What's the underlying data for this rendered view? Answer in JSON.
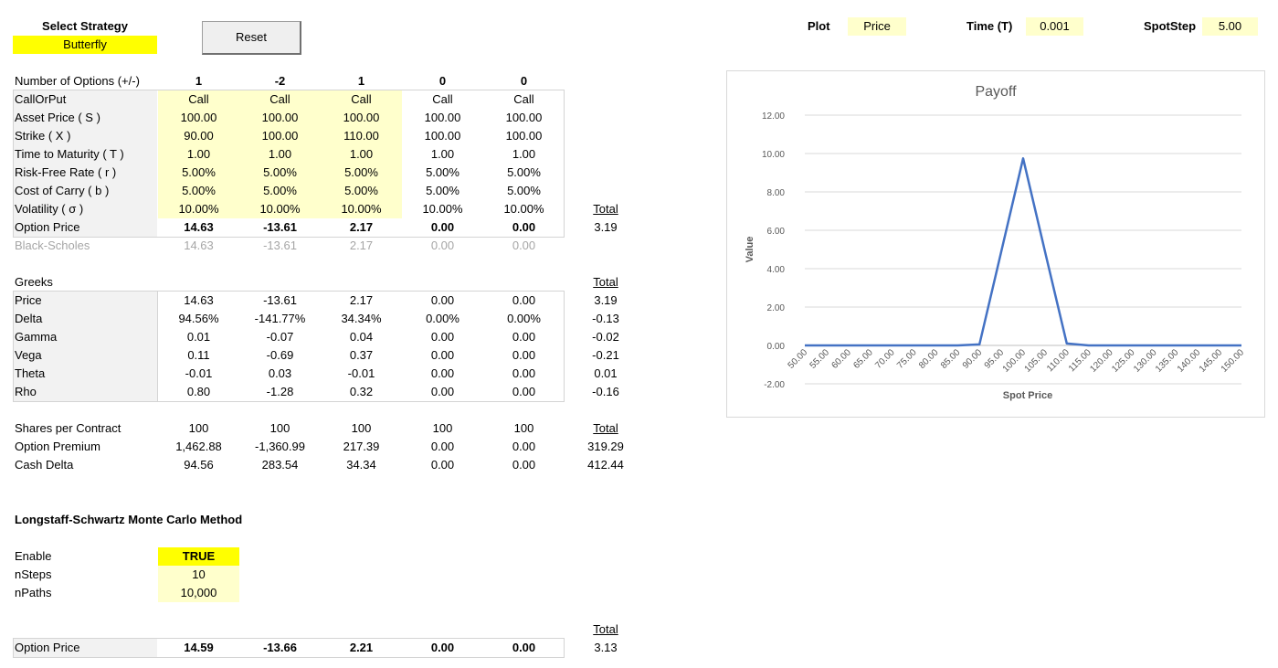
{
  "strategy": {
    "label": "Select Strategy",
    "value": "Butterfly"
  },
  "reset_label": "Reset",
  "controls": {
    "plot": {
      "label": "Plot",
      "value": "Price"
    },
    "time": {
      "label": "Time (T)",
      "value": "0.001"
    },
    "spotstep": {
      "label": "SpotStep",
      "value": "5.00"
    }
  },
  "num_options": {
    "label": "Number of Options (+/-)",
    "values": [
      "1",
      "-2",
      "1",
      "0",
      "0"
    ]
  },
  "inputs": [
    {
      "label": "CallOrPut",
      "values": [
        "Call",
        "Call",
        "Call",
        "Call",
        "Call"
      ]
    },
    {
      "label": "Asset Price ( S )",
      "values": [
        "100.00",
        "100.00",
        "100.00",
        "100.00",
        "100.00"
      ]
    },
    {
      "label": "Strike ( X )",
      "values": [
        "90.00",
        "100.00",
        "110.00",
        "100.00",
        "100.00"
      ]
    },
    {
      "label": "Time to Maturity ( T )",
      "values": [
        "1.00",
        "1.00",
        "1.00",
        "1.00",
        "1.00"
      ]
    },
    {
      "label": "Risk-Free Rate ( r )",
      "values": [
        "5.00%",
        "5.00%",
        "5.00%",
        "5.00%",
        "5.00%"
      ]
    },
    {
      "label": "Cost of Carry ( b )",
      "values": [
        "5.00%",
        "5.00%",
        "5.00%",
        "5.00%",
        "5.00%"
      ]
    },
    {
      "label": "Volatility ( σ )",
      "values": [
        "10.00%",
        "10.00%",
        "10.00%",
        "10.00%",
        "10.00%"
      ]
    }
  ],
  "option_price": {
    "label": "Option Price",
    "values": [
      "14.63",
      "-13.61",
      "2.17",
      "0.00",
      "0.00"
    ],
    "total": "3.19"
  },
  "black_scholes": {
    "label": "Black-Scholes",
    "values": [
      "14.63",
      "-13.61",
      "2.17",
      "0.00",
      "0.00"
    ]
  },
  "total_label": "Total",
  "greeks": {
    "title": "Greeks",
    "rows": [
      {
        "label": "Price",
        "values": [
          "14.63",
          "-13.61",
          "2.17",
          "0.00",
          "0.00"
        ],
        "total": "3.19"
      },
      {
        "label": "Delta",
        "values": [
          "94.56%",
          "-141.77%",
          "34.34%",
          "0.00%",
          "0.00%"
        ],
        "total": "-0.13"
      },
      {
        "label": "Gamma",
        "values": [
          "0.01",
          "-0.07",
          "0.04",
          "0.00",
          "0.00"
        ],
        "total": "-0.02"
      },
      {
        "label": "Vega",
        "values": [
          "0.11",
          "-0.69",
          "0.37",
          "0.00",
          "0.00"
        ],
        "total": "-0.21"
      },
      {
        "label": "Theta",
        "values": [
          "-0.01",
          "0.03",
          "-0.01",
          "0.00",
          "0.00"
        ],
        "total": "0.01"
      },
      {
        "label": "Rho",
        "values": [
          "0.80",
          "-1.28",
          "0.32",
          "0.00",
          "0.00"
        ],
        "total": "-0.16"
      }
    ]
  },
  "contracts": [
    {
      "label": "Shares per Contract",
      "values": [
        "100",
        "100",
        "100",
        "100",
        "100"
      ],
      "total": "Total"
    },
    {
      "label": "Option Premium",
      "values": [
        "1,462.88",
        "-1,360.99",
        "217.39",
        "0.00",
        "0.00"
      ],
      "total": "319.29"
    },
    {
      "label": "Cash Delta",
      "values": [
        "94.56",
        "283.54",
        "34.34",
        "0.00",
        "0.00"
      ],
      "total": "412.44"
    }
  ],
  "monte_carlo": {
    "title": "Longstaff-Schwartz Monte Carlo Method",
    "enable": {
      "label": "Enable",
      "value": "TRUE"
    },
    "nsteps": {
      "label": "nSteps",
      "value": "10"
    },
    "npaths": {
      "label": "nPaths",
      "value": "10,000"
    },
    "option_price": {
      "label": "Option Price",
      "values": [
        "14.59",
        "-13.66",
        "2.21",
        "0.00",
        "0.00"
      ],
      "total": "3.13"
    }
  },
  "chart_data": {
    "type": "line",
    "title": "Payoff",
    "xlabel": "Spot Price",
    "ylabel": "Value",
    "ylim": [
      -2,
      12
    ],
    "yticks": [
      "-2.00",
      "0.00",
      "2.00",
      "4.00",
      "6.00",
      "8.00",
      "10.00",
      "12.00"
    ],
    "yticks_num": [
      -2,
      0,
      2,
      4,
      6,
      8,
      10,
      12
    ],
    "categories": [
      "50.00",
      "55.00",
      "60.00",
      "65.00",
      "70.00",
      "75.00",
      "80.00",
      "85.00",
      "90.00",
      "95.00",
      "100.00",
      "105.00",
      "110.00",
      "115.00",
      "120.00",
      "125.00",
      "130.00",
      "135.00",
      "140.00",
      "145.00",
      "150.00"
    ],
    "values": [
      0,
      0,
      0,
      0,
      0,
      0,
      0,
      0,
      0.05,
      4.9,
      9.75,
      4.9,
      0.1,
      0,
      0,
      0,
      0,
      0,
      0,
      0,
      0
    ],
    "grid": true,
    "color": "#4472c4"
  }
}
